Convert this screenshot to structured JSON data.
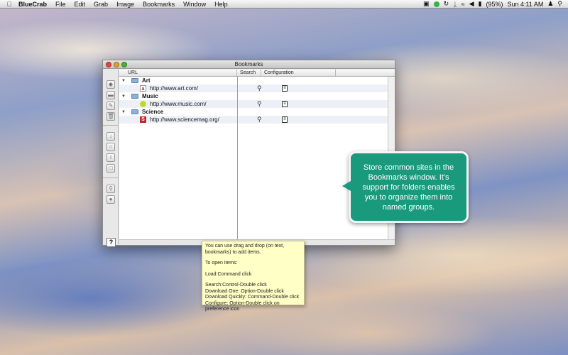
{
  "menubar": {
    "apple": "",
    "items": [
      "BlueCrab",
      "File",
      "Edit",
      "Grab",
      "Image",
      "Bookmarks",
      "Window",
      "Help"
    ],
    "battery": "(95%)",
    "clock": "Sun 4:11 AM"
  },
  "window": {
    "title": "Bookmarks",
    "columns": {
      "url": "URL",
      "search": "Search",
      "config": "Configuration"
    },
    "help_label": "?",
    "folders": [
      {
        "name": "Art",
        "url": "http://www.art.com/",
        "icon_glyph": "a"
      },
      {
        "name": "Music",
        "url": "http://www.music.com/",
        "icon_glyph": ""
      },
      {
        "name": "Science",
        "url": "http://www.sciencemag.org/",
        "icon_glyph": "S"
      }
    ]
  },
  "tooltip": {
    "line1": "You can use drag and drop (on text, bookmarks) to add items.",
    "line2": "To open items:",
    "line3": "Load:Command click",
    "line4": "Search:Control-Double click",
    "line5": "Download One: Option-Double click",
    "line6": "Download Quickly: Command-Double click",
    "line7": "Configure: Option-Double click on preference icon"
  },
  "callout": {
    "text": "Store common sites in the Bookmarks window. It's support for folders enables you to organize them into named groups."
  },
  "colors": {
    "callout_bg": "#1a9a7d",
    "tooltip_bg": "#ffffc6",
    "row_alt": "#edf1f7"
  }
}
